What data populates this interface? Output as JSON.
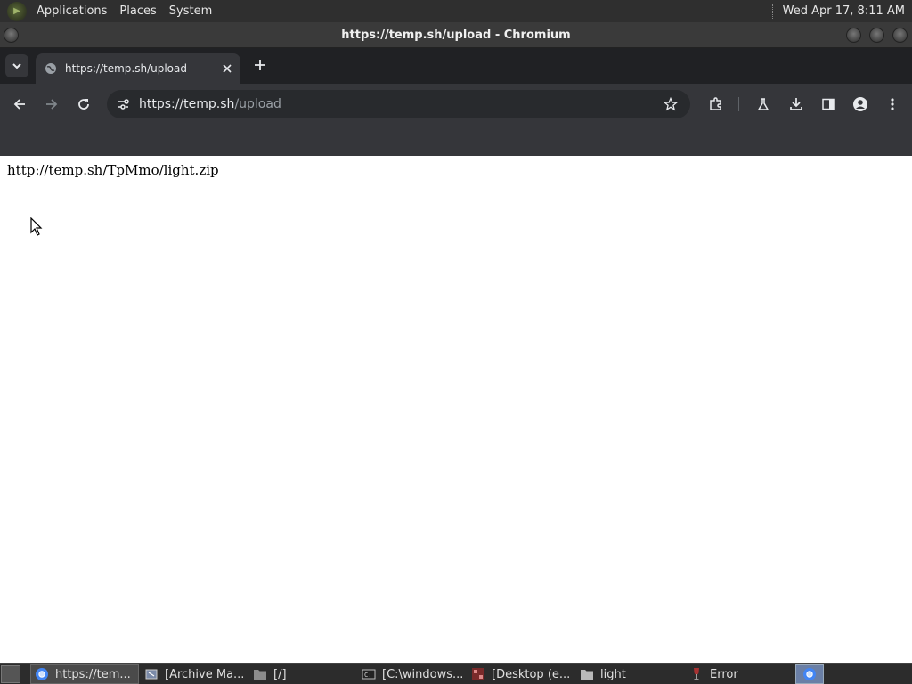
{
  "top_panel": {
    "menus": [
      "Applications",
      "Places",
      "System"
    ],
    "clock": "Wed Apr 17,  8:11 AM"
  },
  "window": {
    "title": "https://temp.sh/upload - Chromium"
  },
  "tab": {
    "title": "https://temp.sh/upload"
  },
  "omnibox": {
    "url_host": "https://temp.sh",
    "url_path": "/upload"
  },
  "page": {
    "text": "http://temp.sh/TpMmo/light.zip"
  },
  "taskbar": {
    "items": [
      {
        "label": "https://tem...",
        "icon": "chromium-icon",
        "active": true
      },
      {
        "label": "[Archive Ma...",
        "icon": "archive-manager-icon",
        "active": false
      },
      {
        "label": "[/]",
        "icon": "folder-icon",
        "active": false
      },
      {
        "label": "[C:\\windows...",
        "icon": "terminal-icon",
        "active": false
      },
      {
        "label": "[Desktop (e...",
        "icon": "app-icon",
        "active": false
      },
      {
        "label": "light",
        "icon": "folder-icon",
        "active": false
      },
      {
        "label": "Error",
        "icon": "wine-icon",
        "active": false
      }
    ]
  },
  "colors": {
    "panel_bg": "#2f2f2f",
    "tab_strip_bg": "#202124",
    "toolbar_bg": "#35363a",
    "omnibox_bg": "#282a2d",
    "page_bg": "#ffffff"
  }
}
